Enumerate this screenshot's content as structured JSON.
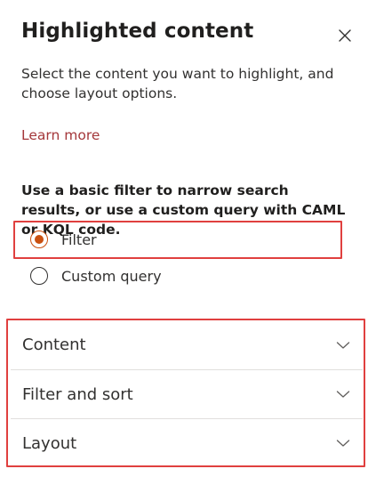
{
  "panel": {
    "title": "Highlighted content",
    "description": "Select the content you want to highlight, and choose layout options.",
    "learn_more": "Learn more",
    "filter_help": "Use a basic filter to narrow search results, or use a custom query with CAML or KQL code.",
    "close_icon": "close-icon"
  },
  "options": [
    {
      "label": "Filter",
      "selected": true
    },
    {
      "label": "Custom query",
      "selected": false
    }
  ],
  "sections": [
    {
      "label": "Content"
    },
    {
      "label": "Filter and sort"
    },
    {
      "label": "Layout"
    }
  ],
  "colors": {
    "accent": "#ca5010",
    "link": "#a4373a",
    "highlight_box": "#e0403f",
    "divider": "#e1dfdd"
  }
}
